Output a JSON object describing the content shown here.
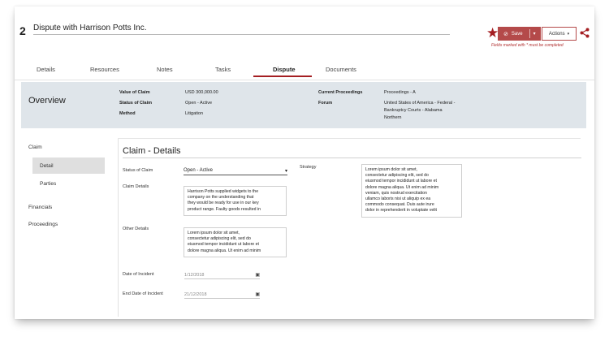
{
  "record": {
    "number": "2",
    "title": "Dispute with Harrison Potts Inc."
  },
  "toolbar": {
    "save_label": "Save",
    "actions_label": "Actions",
    "required_note": "Fields marked with * must be completed"
  },
  "tabs": [
    "Details",
    "Resources",
    "Notes",
    "Tasks",
    "Dispute",
    "Documents"
  ],
  "active_tab": "Dispute",
  "overview": {
    "title": "Overview",
    "value_of_claim_label": "Value of Claim",
    "value_of_claim": "USD 300,000.00",
    "status_label": "Status of Claim",
    "status": "Open - Active",
    "method_label": "Method",
    "method": "Litigation",
    "proceedings_label": "Current Proceedings",
    "proceedings": "Proceedings - A",
    "forum_label": "Forum",
    "forum_lines": [
      "United States of America - Federal -",
      "Bankruptcy Courts - Alabama",
      "Northern"
    ]
  },
  "nav": {
    "claim": "Claim",
    "detail": "Detail",
    "parties": "Parties",
    "financials": "Financials",
    "proceedings": "Proceedings"
  },
  "section": {
    "title": "Claim - Details",
    "status_label": "Status of Claim",
    "status_value": "Open - Active",
    "claim_details_label": "Claim Details",
    "claim_details_lines": [
      "Harrison Potts supplied widgets to the",
      "company on the understanding that",
      "they would be ready for use in our key",
      "product range. Faulty goods resulted in"
    ],
    "other_details_label": "Other Details",
    "other_details_lines": [
      "Lorem ipsum dolor sit amet,",
      "consectetur adipiscing elit, sed do",
      "eiusmod tempor incididunt ut labore et",
      "dolore magna aliqua. Ut enim ad minim"
    ],
    "strategy_label": "Strategy",
    "strategy_lines": [
      "Lorem ipsum dolor sit amet,",
      "consectetur adipiscing elit, sed do",
      "eiusmod tempor incididunt ut labore et",
      "dolore magna aliqua. Ut enim ad minim",
      "veniam, quis nostrud exercitation",
      "ullamco laboris nisi ut aliquip ex ea",
      "commodo consequat. Duis aute irure",
      "dolor in reprehenderit in voluptate velit"
    ],
    "date_incident_label": "Date of Incident",
    "date_incident": "1/12/2018",
    "end_date_label": "End Date of Incident",
    "end_date": "21/12/2018"
  },
  "colors": {
    "accent": "#a41e22",
    "save_button": "#b44a4a",
    "overview_bg": "#dfe5ea"
  }
}
